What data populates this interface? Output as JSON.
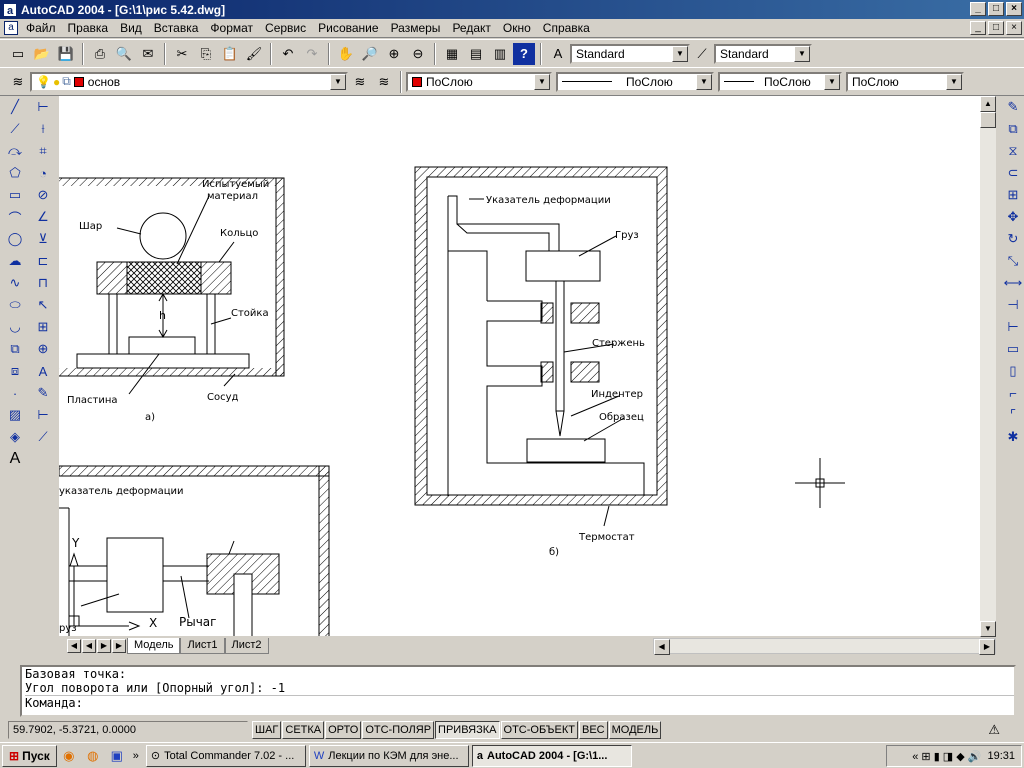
{
  "window": {
    "title": "AutoCAD 2004 - [G:\\1\\рис 5.42.dwg]"
  },
  "menu": [
    "Файл",
    "Правка",
    "Вид",
    "Вставка",
    "Формат",
    "Сервис",
    "Рисование",
    "Размеры",
    "Редакт",
    "Окно",
    "Справка"
  ],
  "toolbar": {
    "text_style": "Standard",
    "dim_style": "Standard"
  },
  "layers": {
    "current": "основ",
    "color": "ПоСлою",
    "linetype": "ПоСлою",
    "lineweight": "ПоСлою",
    "plotstyle": "ПоСлою"
  },
  "drawing": {
    "a": {
      "sphere": "Шар",
      "material": "Испытуемый материал",
      "material_l1": "Испытуемый",
      "material_l2": "материал",
      "ring": "Кольцо",
      "post": "Стойка",
      "h": "h",
      "plate": "Пластина",
      "vessel": "Сосуд",
      "caption": "а)"
    },
    "b": {
      "indicator": "Указатель деформации",
      "load": "Груз",
      "rod": "Стержень",
      "indenter": "Индентер",
      "sample": "Образец",
      "thermostat": "Термостат",
      "caption": "б)"
    },
    "c": {
      "indicator": "указатель деформации",
      "y": "Y",
      "x": "X",
      "lever": "Рычаг",
      "load": "руз"
    }
  },
  "tabs": [
    "Модель",
    "Лист1",
    "Лист2"
  ],
  "command": {
    "line1": "Базовая точка:",
    "line2": "Угол поворота или [Опорный угол]: -1",
    "prompt": "Команда:"
  },
  "status": {
    "coords": "59.7902, -5.3721, 0.0000",
    "buttons": [
      "ШАГ",
      "СЕТКА",
      "ОРТО",
      "ОТС-ПОЛЯР",
      "ПРИВЯЗКА",
      "ОТС-ОБЪЕКТ",
      "ВЕС",
      "МОДЕЛЬ"
    ]
  },
  "taskbar": {
    "start": "Пуск",
    "tasks": [
      "Total Commander 7.02 - ...",
      "Лекции по КЭМ для эне...",
      "AutoCAD 2004 - [G:\\1..."
    ],
    "clock": "19:31"
  }
}
